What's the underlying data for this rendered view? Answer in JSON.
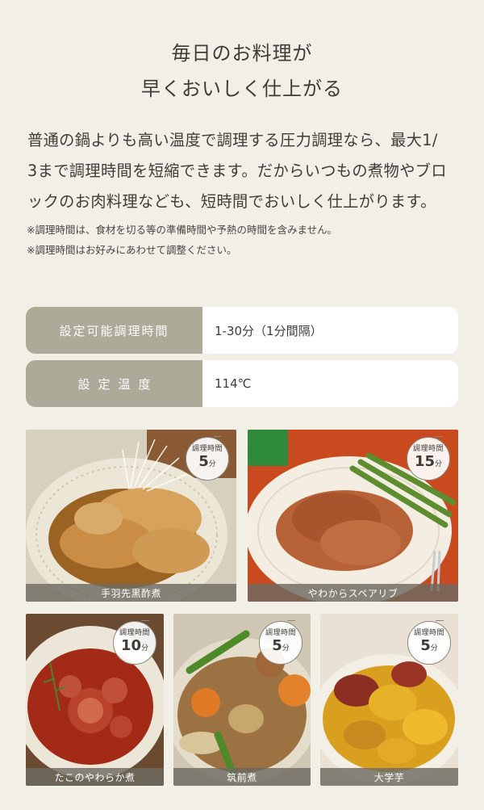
{
  "heading": {
    "line1": "毎日のお料理が",
    "line2": "早くおいしく仕上がる"
  },
  "description": {
    "line1": "普通の鍋よりも高い温度で調理する圧力調理なら、最大1/",
    "line2": "3まで調理時間を短縮できます。だからいつもの煮物やブロ",
    "line3": "ックのお肉料理なども、短時間でおいしく仕上がります。"
  },
  "notes": {
    "note1": "※調理時間は、食材を切る等の準備時間や予熱の時間を含みません。",
    "note2": "※調理時間はお好みにあわせて調整ください。"
  },
  "specs": [
    {
      "label": "設定可能調理時間",
      "value": "1-30分（1分間隔）"
    },
    {
      "label": "設定温度",
      "value": "114℃"
    }
  ],
  "badge_label": "調理時間",
  "badge_unit": "分",
  "dishes": [
    {
      "name": "手羽先黒酢煮",
      "minutes": "5"
    },
    {
      "name": "やわからスペアリブ",
      "minutes": "15"
    },
    {
      "name": "たこのやわらか煮",
      "minutes": "10"
    },
    {
      "name": "筑前煮",
      "minutes": "5"
    },
    {
      "name": "大学芋",
      "minutes": "5"
    }
  ],
  "colors": {
    "background": "#f1efe6",
    "spec_label_bg": "#acaa98",
    "text": "#3f3c37"
  }
}
